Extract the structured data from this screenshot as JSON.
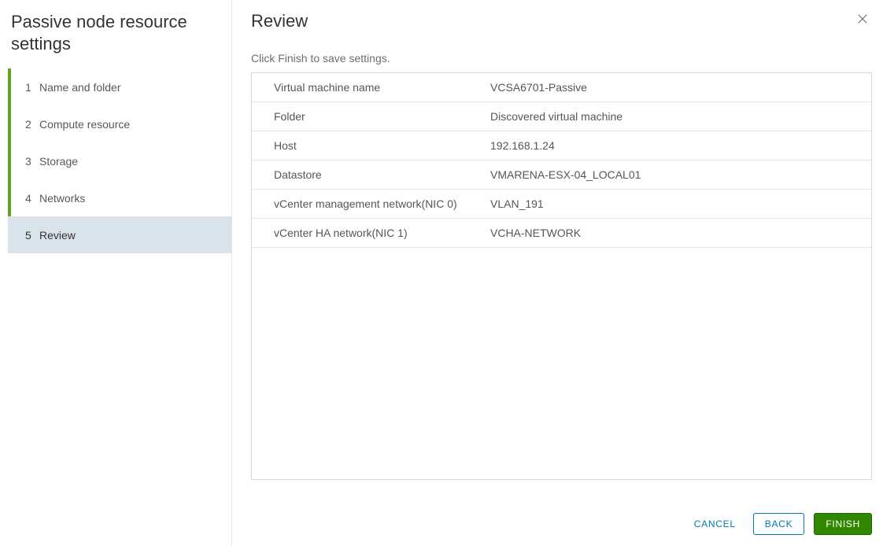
{
  "sidebar": {
    "title": "Passive node resource settings",
    "steps": [
      {
        "num": "1",
        "label": "Name and folder",
        "state": "completed"
      },
      {
        "num": "2",
        "label": "Compute resource",
        "state": "completed"
      },
      {
        "num": "3",
        "label": "Storage",
        "state": "completed"
      },
      {
        "num": "4",
        "label": "Networks",
        "state": "completed"
      },
      {
        "num": "5",
        "label": "Review",
        "state": "active"
      }
    ]
  },
  "main": {
    "title": "Review",
    "subtext": "Click Finish to save settings.",
    "rows": [
      {
        "label": "Virtual machine name",
        "value": "VCSA6701-Passive"
      },
      {
        "label": "Folder",
        "value": "Discovered virtual machine"
      },
      {
        "label": "Host",
        "value": "192.168.1.24"
      },
      {
        "label": "Datastore",
        "value": "VMARENA-ESX-04_LOCAL01"
      },
      {
        "label": "vCenter management network(NIC 0)",
        "value": "VLAN_191"
      },
      {
        "label": "vCenter HA network(NIC 1)",
        "value": "VCHA-NETWORK"
      }
    ]
  },
  "footer": {
    "cancel": "CANCEL",
    "back": "BACK",
    "finish": "FINISH"
  }
}
